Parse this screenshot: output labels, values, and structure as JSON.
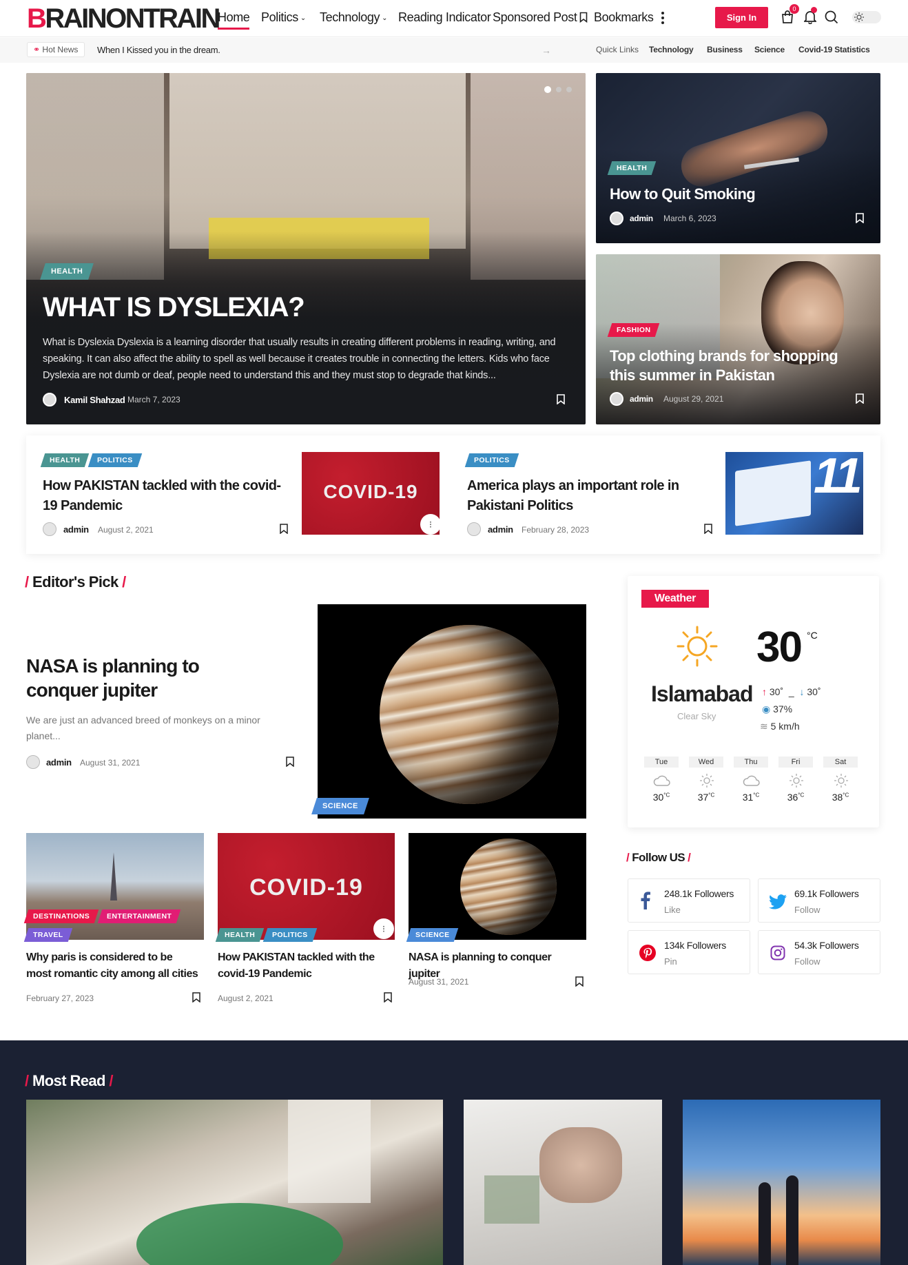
{
  "header": {
    "logo_brand": "B",
    "logo_rest": "RAINONTRAIN",
    "nav": [
      "Home",
      "Politics",
      "Technology",
      "Reading Indicator",
      "Sponsored Post",
      "Bookmarks"
    ],
    "signin": "Sign In",
    "cart_count": "0",
    "accent": "#e7194a"
  },
  "subbar": {
    "hot_news": "Hot News",
    "ticker": "When I Kissed you in the dream.",
    "quick_links_label": "Quick Links",
    "quick_links": [
      "Technology",
      "Business",
      "Science",
      "Covid-19 Statistics"
    ]
  },
  "hero": {
    "category": "HEALTH",
    "title": "WHAT IS DYSLEXIA?",
    "excerpt": "What is Dyslexia Dyslexia is a learning disorder that usually results in creating different problems in reading, writing, and speaking. It can also affect the ability to spell as well because it creates trouble in connecting the letters. Kids who face Dyslexia are not dumb or deaf, people need to understand this and they must stop to degrade that kinds...",
    "author": "Kamil Shahzad",
    "date": "March 7, 2023"
  },
  "side_cards": [
    {
      "category": "HEALTH",
      "title": "How to Quit Smoking",
      "author": "admin",
      "date": "March 6, 2023"
    },
    {
      "category": "FASHION",
      "title": "Top clothing brands for shopping this summer in Pakistan",
      "author": "admin",
      "date": "August 29, 2021"
    }
  ],
  "strip": [
    {
      "categories": [
        "HEALTH",
        "POLITICS"
      ],
      "title": "How PAKISTAN tackled with the covid-19 Pandemic",
      "author": "admin",
      "date": "August 2, 2021",
      "image_text": "COVID-19"
    },
    {
      "categories": [
        "POLITICS"
      ],
      "title": "America plays an important role in Pakistani Politics",
      "author": "admin",
      "date": "February 28, 2023",
      "image_text": "11"
    }
  ],
  "editors_pick": {
    "heading": "Editor's Pick",
    "feature": {
      "title": "NASA is planning to conquer jupiter",
      "excerpt": "We are just an advanced breed of monkeys on a minor planet...",
      "author": "admin",
      "date": "August 31, 2021",
      "category": "SCIENCE"
    },
    "grid": [
      {
        "categories": [
          "DESTINATIONS",
          "ENTERTAINMENT",
          "TRAVEL"
        ],
        "title": "Why paris is considered to be most romantic city among all cities",
        "date": "February 27, 2023"
      },
      {
        "categories": [
          "HEALTH",
          "POLITICS"
        ],
        "title": "How PAKISTAN tackled with the covid-19 Pandemic",
        "date": "August 2, 2021",
        "image_text": "COVID-19"
      },
      {
        "categories": [
          "SCIENCE"
        ],
        "title": "NASA is planning to conquer jupiter",
        "date": "August 31, 2021"
      }
    ]
  },
  "weather": {
    "label": "Weather",
    "temp": "30",
    "unit": "°C",
    "city": "Islamabad",
    "condition": "Clear Sky",
    "high": "30˚",
    "low": "30˚",
    "humidity": "37%",
    "wind": "5 km/h",
    "forecast": [
      {
        "day": "Tue",
        "temp": "30",
        "icon": "cloud-icon"
      },
      {
        "day": "Wed",
        "temp": "37",
        "icon": "sun-icon"
      },
      {
        "day": "Thu",
        "temp": "31",
        "icon": "cloud-icon"
      },
      {
        "day": "Fri",
        "temp": "36",
        "icon": "sun-icon"
      },
      {
        "day": "Sat",
        "temp": "38",
        "icon": "sun-icon"
      }
    ],
    "deg": "°C"
  },
  "follow": {
    "heading": "Follow US",
    "items": [
      {
        "network": "facebook",
        "count": "248.1k Followers",
        "action": "Like",
        "color": "#3b5998"
      },
      {
        "network": "twitter",
        "count": "69.1k Followers",
        "action": "Follow",
        "color": "#1da1f2"
      },
      {
        "network": "pinterest",
        "count": "134k Followers",
        "action": "Pin",
        "color": "#e60023"
      },
      {
        "network": "instagram",
        "count": "54.3k Followers",
        "action": "Follow",
        "color": "#8134af"
      }
    ]
  },
  "most_read": {
    "heading": "Most Read"
  }
}
